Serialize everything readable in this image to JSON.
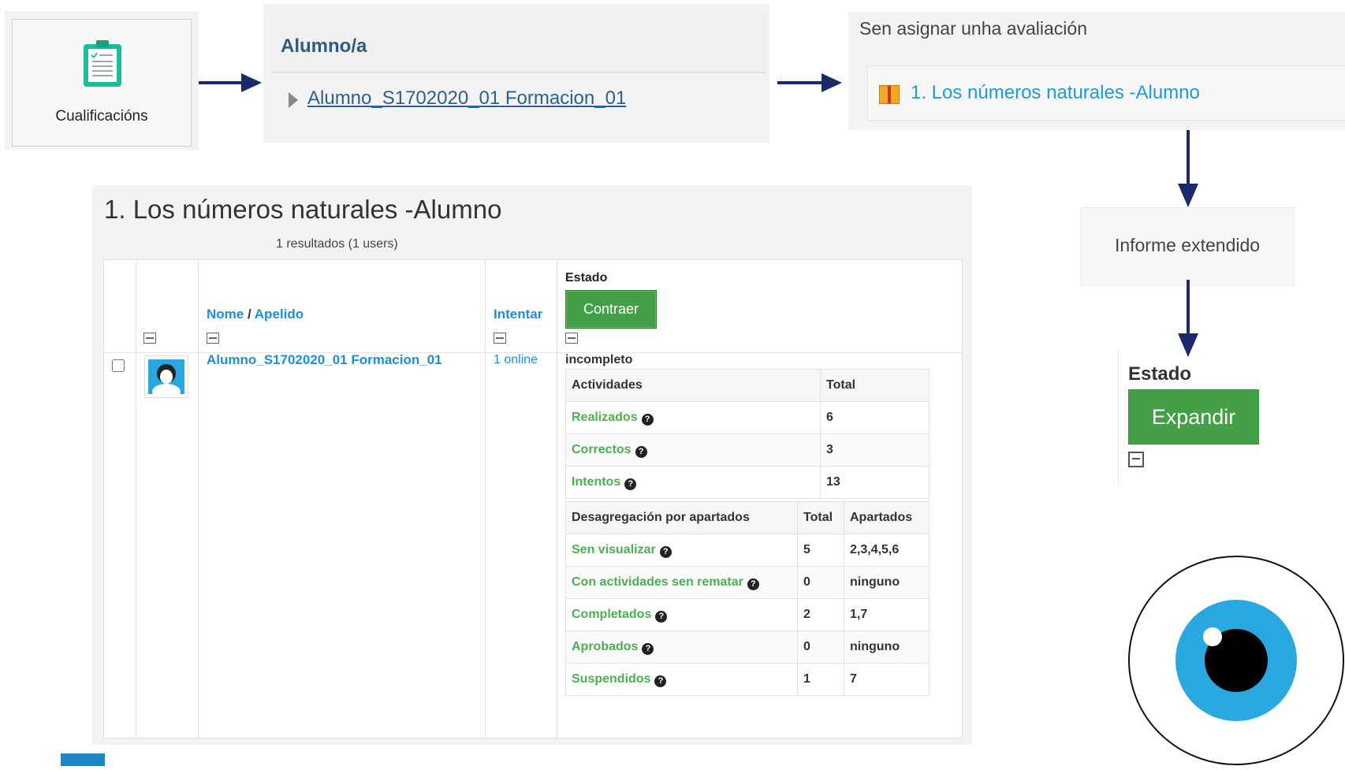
{
  "step1": {
    "label": "Cualificacións",
    "icon": "clipboard-icon"
  },
  "step2": {
    "header": "Alumno/a",
    "student_link": "Alumno_S1702020_01 Formacion_01"
  },
  "step3": {
    "title": "Sen asignar unha avaliación",
    "item": "1. Los números naturales -Alumno",
    "icon": "package-icon"
  },
  "step4": {
    "label": "Informe extendido"
  },
  "step5": {
    "estado_label": "Estado",
    "button": "Expandir"
  },
  "report": {
    "title": "1. Los números naturales -Alumno",
    "results": "1 resultados (1 users)",
    "headers": {
      "nome": "Nome",
      "sep": " / ",
      "apelido": "Apelido",
      "intentar": "Intentar",
      "estado": "Estado",
      "contraer": "Contraer"
    },
    "row": {
      "name": "Alumno_S1702020_01 Formacion_01",
      "attempt": "1 online",
      "status": "incompleto"
    },
    "activities": {
      "col1": "Actividades",
      "col2": "Total",
      "rows": [
        {
          "label": "Realizados",
          "total": "6"
        },
        {
          "label": "Correctos",
          "total": "3"
        },
        {
          "label": "Intentos",
          "total": "13"
        }
      ]
    },
    "breakdown": {
      "col1": "Desagregación por apartados",
      "col2": "Total",
      "col3": "Apartados",
      "rows": [
        {
          "label": "Sen visualizar",
          "total": "5",
          "sections": "2,3,4,5,6"
        },
        {
          "label": "Con actividades sen rematar",
          "total": "0",
          "sections": "ninguno"
        },
        {
          "label": "Completados",
          "total": "2",
          "sections": "1,7"
        },
        {
          "label": "Aprobados",
          "total": "0",
          "sections": "ninguno"
        },
        {
          "label": "Suspendidos",
          "total": "1",
          "sections": "7"
        }
      ]
    },
    "help_glyph": "?"
  },
  "colors": {
    "accent_blue": "#1e8fd6",
    "green_button": "#43a047",
    "arrow_navy": "#1a2a6c",
    "eye_iris": "#29a8e0"
  }
}
